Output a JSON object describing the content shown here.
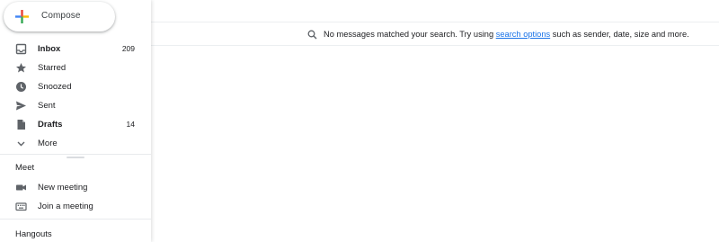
{
  "compose": {
    "label": "Compose"
  },
  "nav": {
    "items": [
      {
        "label": "Inbox",
        "count": "209",
        "icon": "inbox-icon",
        "bold": true
      },
      {
        "label": "Starred",
        "count": "",
        "icon": "star-icon",
        "bold": false
      },
      {
        "label": "Snoozed",
        "count": "",
        "icon": "clock-icon",
        "bold": false
      },
      {
        "label": "Sent",
        "count": "",
        "icon": "send-icon",
        "bold": false
      },
      {
        "label": "Drafts",
        "count": "14",
        "icon": "draft-icon",
        "bold": true
      },
      {
        "label": "More",
        "count": "",
        "icon": "chevron-down-icon",
        "bold": false
      }
    ]
  },
  "meet": {
    "title": "Meet",
    "items": [
      {
        "label": "New meeting",
        "icon": "videocam-icon"
      },
      {
        "label": "Join a meeting",
        "icon": "keyboard-icon"
      }
    ]
  },
  "hangouts": {
    "title": "Hangouts"
  },
  "main": {
    "empty_prefix": "No messages matched your search. Try using ",
    "empty_link": "search options",
    "empty_suffix": " such as sender, date, size and more."
  },
  "colors": {
    "link": "#1a73e8",
    "icon": "#5f6368",
    "compose_red": "#ea4335",
    "compose_blue": "#4285f4",
    "compose_yellow": "#fbbc04",
    "compose_green": "#34a853"
  }
}
